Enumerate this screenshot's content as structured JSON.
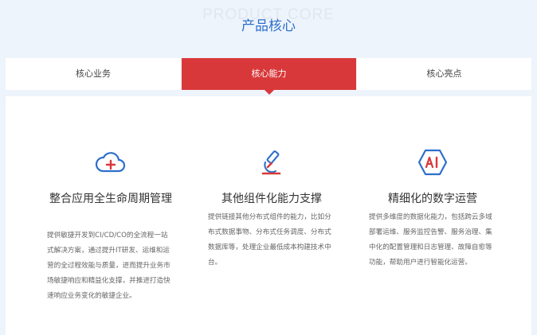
{
  "header": {
    "watermark": "PRODUCT CORE",
    "title": "产品核心"
  },
  "tabs": [
    {
      "label": "核心业务",
      "active": false
    },
    {
      "label": "核心能力",
      "active": true
    },
    {
      "label": "核心亮点",
      "active": false
    }
  ],
  "colors": {
    "accent_red": "#d9383a",
    "brand_blue": "#2e6fcb",
    "background": "#eef4fb"
  },
  "features": [
    {
      "icon": "cloud-plus-icon",
      "title": "整合应用全生命周期管理",
      "description": "提供敏捷开发到CI/CD/CO的全流程一站式解决方案，通过提升IT研发、运维和运营的全过程效能与质量，进而提升业务市场敏捷响应和精益化支撑，并推进打造快速响应业务变化的敏捷企业。"
    },
    {
      "icon": "microscope-icon",
      "title": "其他组件化能力支撑",
      "description": "提供链接其他分布式组件的能力，比如分布式数据事物、分布式任务调度、分布式数据库等，处理企业最低成本构建技术中台。"
    },
    {
      "icon": "ai-hexagon-icon",
      "title": "精细化的数字运营",
      "description": "提供多维度的数据化能力，包括跨云多域部署运维、服务监控告警、服务治理、集中化的配置管理和日志管理、故障自愈等功能，帮助用户进行智能化运营。"
    }
  ]
}
